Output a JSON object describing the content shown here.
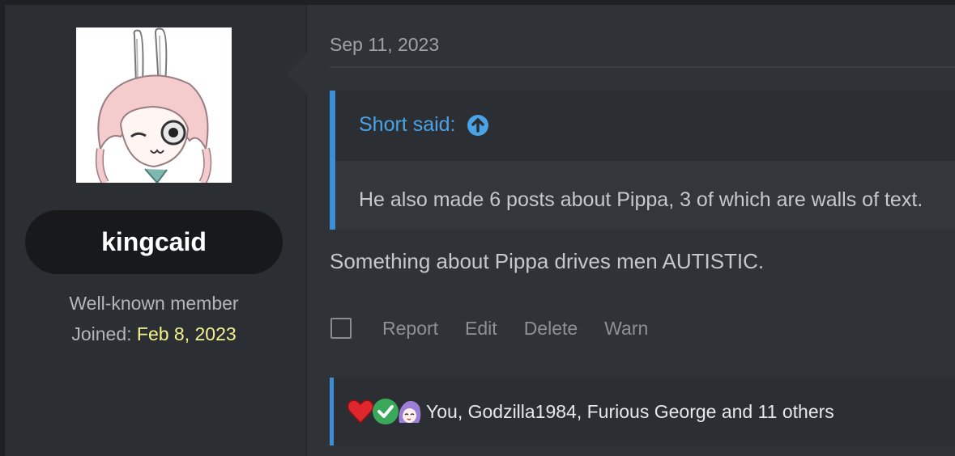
{
  "user": {
    "username": "kingcaid",
    "title": "Well-known member",
    "joined_label": "Joined:",
    "joined_date": "Feb 8, 2023",
    "avatar_icon": "anime-bunny-girl-avatar"
  },
  "post": {
    "date": "Sep 11, 2023",
    "quote": {
      "author_line": "Short said:",
      "jump_icon": "arrow-up-circle-icon",
      "text": "He also made 6 posts about Pippa, 3 of which are walls of text."
    },
    "body": "Something about Pippa drives men AUTISTIC.",
    "actions": [
      "Report",
      "Edit",
      "Delete",
      "Warn"
    ],
    "reactions": {
      "icons": [
        "heart-icon",
        "check-icon",
        "anime-face-icon"
      ],
      "text": "You, Godzilla1984, Furious George and 11 others"
    }
  },
  "colors": {
    "accent": "#3a8fd6",
    "link": "#4aa3e6",
    "joined_date": "#f4f28f",
    "background": "#2f3236"
  }
}
